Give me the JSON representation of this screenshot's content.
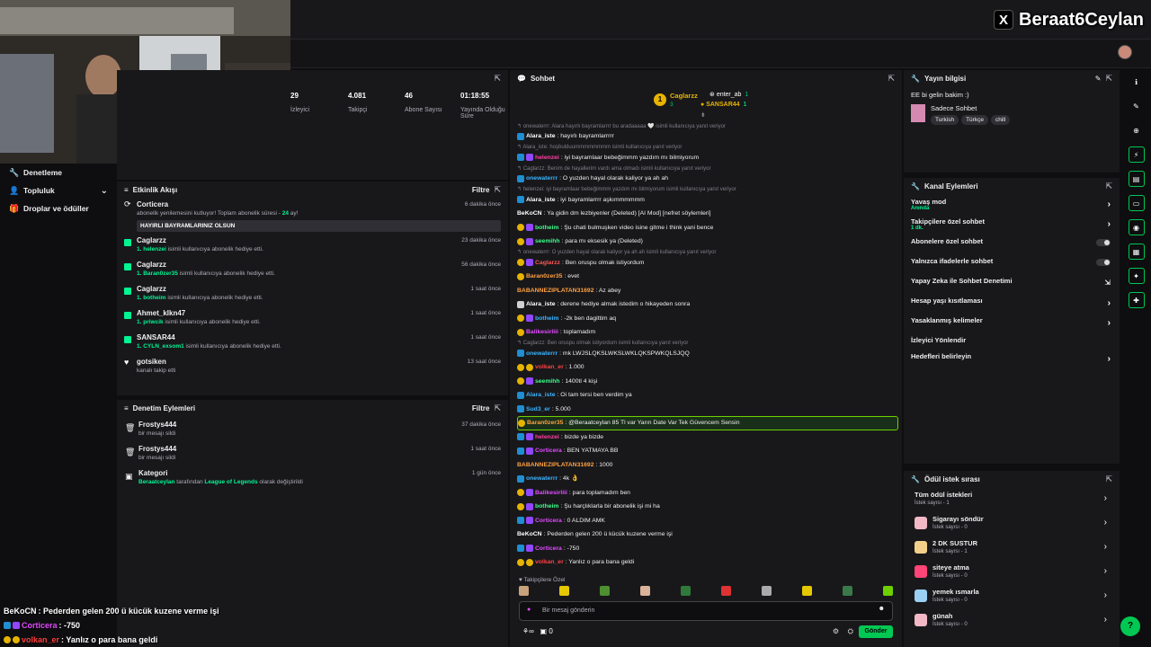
{
  "brand": {
    "x_label": "X",
    "name": "Beraat6Ceylan"
  },
  "leftnav": [
    {
      "label": "Denetleme",
      "icon": "wrench-icon"
    },
    {
      "label": "Topluluk",
      "icon": "person-icon",
      "chevron": "⌄"
    },
    {
      "label": "Droplar ve ödüller",
      "icon": "gift-icon"
    }
  ],
  "stats": [
    {
      "value": "29",
      "label": "İzleyici"
    },
    {
      "value": "4.081",
      "label": "Takipçi"
    },
    {
      "value": "46",
      "label": "Abone Sayısı"
    },
    {
      "value": "01:18:55",
      "label": "Yayında Olduğu Süre"
    }
  ],
  "events": {
    "title": "Etkinlik Akışı",
    "filter": "Filtre",
    "items": [
      {
        "name": "Corticera",
        "desc_pre": "abonelik yenilemesini kutluyor! Toplam abonelik süresi - ",
        "desc_hl": "24",
        "desc_post": " ay!",
        "time": "6 dakika önce",
        "message": "HAYIRLI BAYRAMLARINIZ OLSUN",
        "icon": "sub"
      },
      {
        "name": "Caglarzz",
        "desc_hl": "1. helenzei",
        "desc_post": " isimli kullanıcıya abonelik hediye etti.",
        "time": "23 dakika önce",
        "icon": "gift"
      },
      {
        "name": "Caglarzz",
        "desc_hl": "1. Baran0zer35",
        "desc_post": " isimli kullanıcıya abonelik hediye etti.",
        "time": "56 dakika önce",
        "icon": "gift"
      },
      {
        "name": "Caglarzz",
        "desc_hl": "1. botheim",
        "desc_post": " isimli kullanıcıya abonelik hediye etti.",
        "time": "1 saat önce",
        "icon": "gift"
      },
      {
        "name": "Ahmet_klkn47",
        "desc_hl": "1. priwcik",
        "desc_post": " isimli kullanıcıya abonelik hediye etti.",
        "time": "1 saat önce",
        "icon": "gift"
      },
      {
        "name": "SANSAR44",
        "desc_hl": "1. CYLN_exsom1",
        "desc_post": " isimli kullanıcıya abonelik hediye etti.",
        "time": "1 saat önce",
        "icon": "gift"
      },
      {
        "name": "gotsiken",
        "desc_post": "kanalı takip etti",
        "time": "13 saat önce",
        "icon": "heart"
      }
    ]
  },
  "modactions": {
    "title": "Denetim Eylemleri",
    "filter": "Filtre",
    "items": [
      {
        "name": "Frostys444",
        "desc": "bir mesajı sildi",
        "time": "37 dakika önce",
        "icon": "trash-icon"
      },
      {
        "name": "Frostys444",
        "desc": "bir mesajı sildi",
        "time": "1 saat önce",
        "icon": "trash-icon"
      },
      {
        "name": "Kategori",
        "desc_a": "Beraatceylan",
        "desc_b": " tarafından ",
        "desc_c": "League of Legends",
        "desc_d": " olarak değiştirildi",
        "time": "1 gün önce",
        "icon": "category-icon"
      }
    ]
  },
  "overlay_chat": [
    {
      "user": "BeKoCN",
      "color": "#ffffff",
      "text": " : Pederden gelen 200 ü kücük kuzene verme işi"
    },
    {
      "user": "Corticera",
      "color": "#e24cff",
      "text": " : -750",
      "badges": [
        "b-blue",
        "b-purple"
      ]
    },
    {
      "user": "volkan_er",
      "color": "#ff4040",
      "text": " : Yanlız o para bana geldi",
      "badges": [
        "b-gold",
        "b-gold"
      ]
    }
  ],
  "chat": {
    "title": "Sohbet",
    "top": [
      {
        "user": "Caglarzz",
        "count": "3"
      },
      {
        "user": "enter_ab",
        "count": "1"
      },
      {
        "user": "SANSAR44",
        "count": "1"
      }
    ],
    "messages": [
      {
        "reply": "↰ onewaterrr: Alara hayırlı bayramlarrrr bu aradaaaaa 🤍 isimli kullanıcıya yanıt veriyor"
      },
      {
        "badges": [
          "b-blue"
        ],
        "user": "Alara_iste",
        "ucolor": "#ffffff",
        "text": ": hayırlı bayramlarrrrr"
      },
      {
        "reply": "↰ Alara_iste: hoşbulduummmmmmmm isimli kullanıcıya yanıt veriyor"
      },
      {
        "badges": [
          "b-blue",
          "b-purple"
        ],
        "user": "helenzei",
        "ucolor": "#ff3fa0",
        "text": ": iyi bayramlaar bebeğimmm yazdım mı bilmiyorum"
      },
      {
        "reply": "↰ Caglarzz: Benim de hayallerim vardı ama olmadı isimli kullanıcıya yanıt veriyor"
      },
      {
        "badges": [
          "b-blue"
        ],
        "user": "onewaterrr",
        "ucolor": "#3ab4ff",
        "text": ": O yuzden hayal olarak kaliyor ya ah ah"
      },
      {
        "reply": "↰ helenzei: iyi bayramlaar bebeğimmm yazdım mı bilmiyorum isimli kullanıcıya yanıt veriyor"
      },
      {
        "badges": [
          "b-blue"
        ],
        "user": "Alara_iste",
        "ucolor": "#ffffff",
        "text": ": iyi bayramlarrrr aşkımmmmmm"
      },
      {
        "user": "BeKoCN",
        "ucolor": "#ffffff",
        "text": ": Ya gidin dm lezbiyenler (Deleted) [AI Mod] [nefret söylemleri]"
      },
      {
        "badges": [
          "b-gold",
          "b-purple"
        ],
        "user": "botheim",
        "ucolor": "#3dff8a",
        "text": ": Şu chati bulmuşken video isine gitme i think yani bence"
      },
      {
        "badges": [
          "b-gold",
          "b-purple"
        ],
        "user": "seemihh",
        "ucolor": "#3dff8a",
        "text": ": para mı eksesik ya (Deleted)"
      },
      {
        "reply": "↰ onewaterrr: O yuzden hayal olarak kaliyor ya ah ah isimli kullanıcıya yanıt veriyor"
      },
      {
        "badges": [
          "b-gold",
          "b-purple"
        ],
        "user": "Caglarzz",
        "ucolor": "#ff5555",
        "text": ": Ben oruspu olmak istiyordum"
      },
      {
        "badges": [
          "b-gold"
        ],
        "user": "Baran0zer35",
        "ucolor": "#ffa040",
        "text": ": evet"
      },
      {
        "user": "BABANNEZIPLATAN31692",
        "ucolor": "#ffa040",
        "text": ": Az abey"
      },
      {
        "badges": [
          "b-grey"
        ],
        "user": "Alara_iste",
        "ucolor": "#ffffff",
        "text": ": derene hediye almak istedim o hikayeden sonra"
      },
      {
        "badges": [
          "b-gold",
          "b-purple"
        ],
        "user": "botheim",
        "ucolor": "#3ab4ff",
        "text": ": -2k ben dagittim aq"
      },
      {
        "badges": [
          "b-gold"
        ],
        "user": "Balikesirliii",
        "ucolor": "#e24cff",
        "text": ": toplamadım"
      },
      {
        "reply": "↰ Caglarzz: Ben oruspu olmak istiyordum isimli kullanıcıya yanıt veriyor"
      },
      {
        "badges": [
          "b-blue"
        ],
        "user": "onewaterrr",
        "ucolor": "#3ab4ff",
        "text": ": mk LWJSLQKSLWKSLWKLQKSPWKQLSJQQ"
      },
      {
        "badges": [
          "b-gold",
          "b-gold"
        ],
        "user": "volkan_er",
        "ucolor": "#ff4040",
        "text": ": 1.000"
      },
      {
        "badges": [
          "b-gold",
          "b-purple"
        ],
        "user": "seemihh",
        "ucolor": "#3dff8a",
        "text": ": 1400tl 4 kişi"
      },
      {
        "badges": [
          "b-blue"
        ],
        "user": "Alara_iste",
        "ucolor": "#3ab4ff",
        "text": ": Oi tam tersi ben verdim ya"
      },
      {
        "badges": [
          "b-blue"
        ],
        "user": "Sud3_er",
        "ucolor": "#3ab4ff",
        "text": ": 5.000"
      },
      {
        "highlight": true,
        "badges": [
          "b-gold"
        ],
        "user": "Baran0zer35",
        "ucolor": "#ffa040",
        "text": ": @Beraatceylan 85 Tl var Yarın Date Var Tek Güvencem Sensin"
      },
      {
        "badges": [
          "b-blue",
          "b-purple"
        ],
        "user": "helenzei",
        "ucolor": "#ff3fa0",
        "text": ": bizde ya bizde"
      },
      {
        "badges": [
          "b-blue",
          "b-purple"
        ],
        "user": "Corticera",
        "ucolor": "#e24cff",
        "text": ": BEN YATMAYA BB"
      },
      {
        "user": "BABANNEZIPLATAN31692",
        "ucolor": "#ffa040",
        "text": ": 1000"
      },
      {
        "badges": [
          "b-blue"
        ],
        "user": "onewaterrr",
        "ucolor": "#3ab4ff",
        "text": ": 4k 👌"
      },
      {
        "badges": [
          "b-gold",
          "b-purple"
        ],
        "user": "Balikesirliii",
        "ucolor": "#e24cff",
        "text": ": para toplamadım ben"
      },
      {
        "badges": [
          "b-gold",
          "b-purple"
        ],
        "user": "botheim",
        "ucolor": "#3dff8a",
        "text": ": Şu harçlıklarla bir abonelik işi mi ha"
      },
      {
        "badges": [
          "b-blue",
          "b-purple"
        ],
        "user": "Corticera",
        "ucolor": "#e24cff",
        "text": ": 0 ALDIM AMK"
      },
      {
        "user": "BeKoCN",
        "ucolor": "#ffffff",
        "text": ": Pederden gelen 200 ü kücük kuzene verme işi"
      },
      {
        "badges": [
          "b-blue",
          "b-purple"
        ],
        "user": "Corticera",
        "ucolor": "#e24cff",
        "text": ": -750"
      },
      {
        "badges": [
          "b-gold",
          "b-gold"
        ],
        "user": "volkan_er",
        "ucolor": "#ff4040",
        "text": ": Yanlız o para bana geldi"
      }
    ],
    "emote_label": "♥ Takipçilere Özel",
    "input_placeholder": "Bir mesaj gönderin",
    "points": "0",
    "send": "Gönder"
  },
  "info": {
    "title": "Yayın bilgisi",
    "stream_title": "EE bi gelin bakim :)",
    "category": "Sadece Sohbet",
    "tags": [
      "Turkish",
      "Türkçe",
      "chill"
    ]
  },
  "channel_actions": {
    "title": "Kanal Eylemleri",
    "items": [
      {
        "label": "Yavaş mod",
        "sub": "Anında",
        "kind": "arrow"
      },
      {
        "label": "Takipçilere özel sohbet",
        "sub": "1 dk.",
        "kind": "arrow"
      },
      {
        "label": "Abonelere özel sohbet",
        "kind": "toggle"
      },
      {
        "label": "Yalnızca ifadelerle sohbet",
        "kind": "toggle"
      },
      {
        "label": "Yapay Zeka ile Sohbet Denetimi",
        "kind": "ext"
      },
      {
        "label": "Hesap yaşı kısıtlaması",
        "kind": "arrow"
      },
      {
        "label": "Yasaklanmış kelimeler",
        "kind": "arrow"
      },
      {
        "label": "İzleyici Yönlendir",
        "kind": "none"
      },
      {
        "label": "Hedefleri belirleyin",
        "kind": "arrow"
      }
    ]
  },
  "rewards": {
    "title": "Ödül istek sırası",
    "items": [
      {
        "name": "Tüm ödül istekleri",
        "desc": "İstek sayısı - 1",
        "icon": "none"
      },
      {
        "name": "Sigarayı söndür",
        "desc": "İstek sayısı - 0",
        "icon": "#f2b8c6"
      },
      {
        "name": "2 DK SUSTUR",
        "desc": "İstek sayısı - 1",
        "icon": "#f2d08a"
      },
      {
        "name": "siteye atma",
        "desc": "İstek sayısı - 0",
        "icon": "#ff4477"
      },
      {
        "name": "yemek ısmarla",
        "desc": "İstek sayısı - 0",
        "icon": "#9ad0f2"
      },
      {
        "name": "günah",
        "desc": "İstek sayısı - 0",
        "icon": "#f2b8c6"
      }
    ]
  }
}
